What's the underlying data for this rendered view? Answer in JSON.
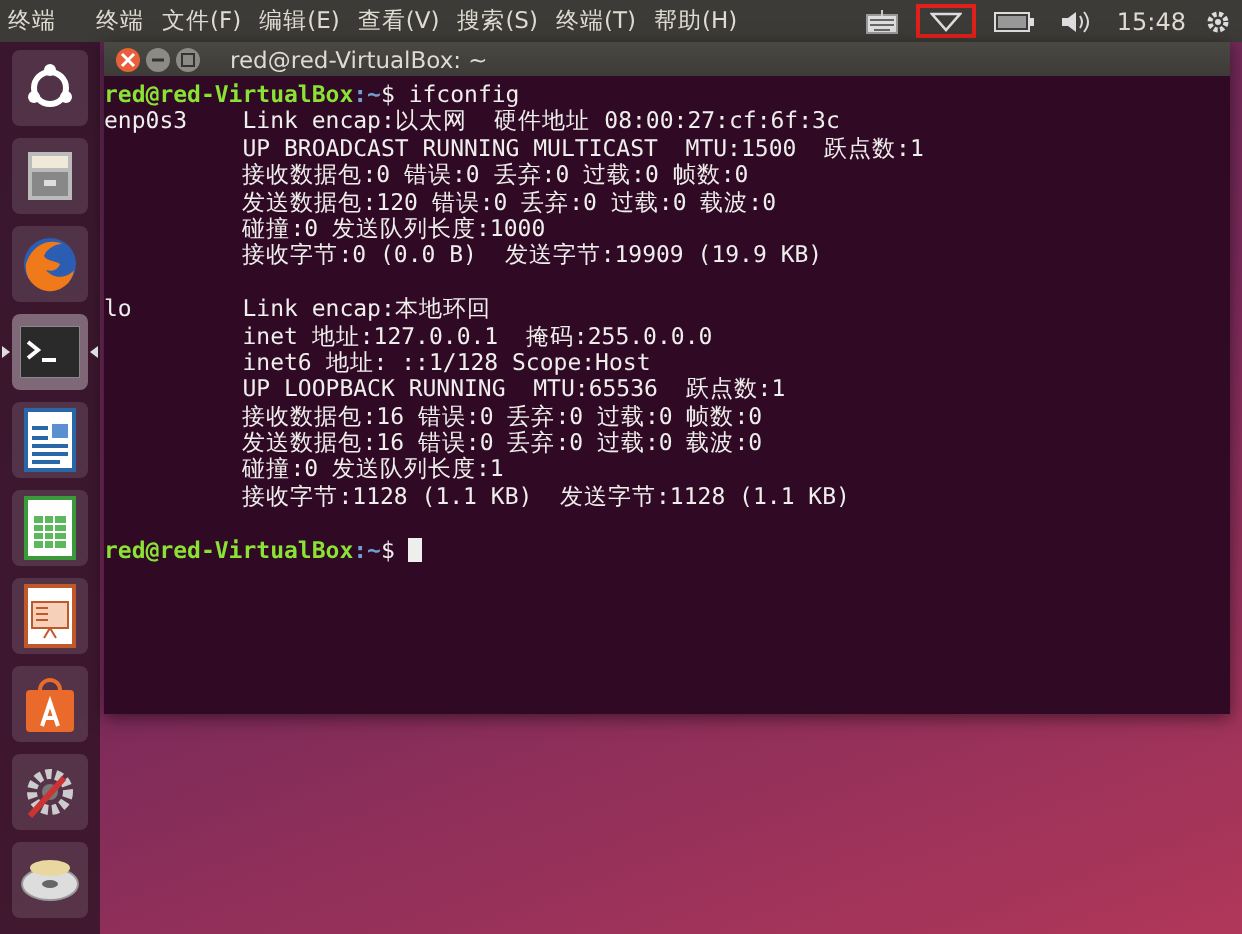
{
  "top_panel": {
    "app_title": "终端",
    "menus": [
      "终端",
      "文件(F)",
      "编辑(E)",
      "查看(V)",
      "搜索(S)",
      "终端(T)",
      "帮助(H)"
    ],
    "indicators": [
      {
        "kind": "keyboard",
        "highlighted": false
      },
      {
        "kind": "wifi",
        "highlighted": true
      },
      {
        "kind": "battery",
        "highlighted": false
      },
      {
        "kind": "volume",
        "highlighted": false
      }
    ],
    "time": "15:48"
  },
  "launcher": [
    {
      "kind": "ubuntu",
      "selected": false
    },
    {
      "kind": "files",
      "selected": false
    },
    {
      "kind": "firefox",
      "selected": false
    },
    {
      "kind": "terminal",
      "selected": true
    },
    {
      "kind": "writer",
      "selected": false
    },
    {
      "kind": "calc",
      "selected": false
    },
    {
      "kind": "impress",
      "selected": false
    },
    {
      "kind": "software",
      "selected": false
    },
    {
      "kind": "settings",
      "selected": false
    },
    {
      "kind": "disc",
      "selected": false
    }
  ],
  "terminal": {
    "title": "red@red-VirtualBox: ~",
    "lines": [
      {
        "kind": "prompt",
        "user_host": "red@red-VirtualBox",
        "path": ":~",
        "command": "$ ifconfig",
        "cursor": false
      },
      {
        "kind": "output",
        "text": "enp0s3    Link encap:以太网  硬件地址 08:00:27:cf:6f:3c"
      },
      {
        "kind": "output",
        "text": "          UP BROADCAST RUNNING MULTICAST  MTU:1500  跃点数:1"
      },
      {
        "kind": "output",
        "text": "          接收数据包:0 错误:0 丢弃:0 过载:0 帧数:0"
      },
      {
        "kind": "output",
        "text": "          发送数据包:120 错误:0 丢弃:0 过载:0 载波:0"
      },
      {
        "kind": "output",
        "text": "          碰撞:0 发送队列长度:1000"
      },
      {
        "kind": "output",
        "text": "          接收字节:0 (0.0 B)  发送字节:19909 (19.9 KB)"
      },
      {
        "kind": "blank"
      },
      {
        "kind": "output",
        "text": "lo        Link encap:本地环回"
      },
      {
        "kind": "output",
        "text": "          inet 地址:127.0.0.1  掩码:255.0.0.0"
      },
      {
        "kind": "output",
        "text": "          inet6 地址: ::1/128 Scope:Host"
      },
      {
        "kind": "output",
        "text": "          UP LOOPBACK RUNNING  MTU:65536  跃点数:1"
      },
      {
        "kind": "output",
        "text": "          接收数据包:16 错误:0 丢弃:0 过载:0 帧数:0"
      },
      {
        "kind": "output",
        "text": "          发送数据包:16 错误:0 丢弃:0 过载:0 载波:0"
      },
      {
        "kind": "output",
        "text": "          碰撞:0 发送队列长度:1"
      },
      {
        "kind": "output",
        "text": "          接收字节:1128 (1.1 KB)  发送字节:1128 (1.1 KB)"
      },
      {
        "kind": "blank"
      },
      {
        "kind": "prompt",
        "user_host": "red@red-VirtualBox",
        "path": ":~",
        "command": "$ ",
        "cursor": true
      }
    ]
  }
}
